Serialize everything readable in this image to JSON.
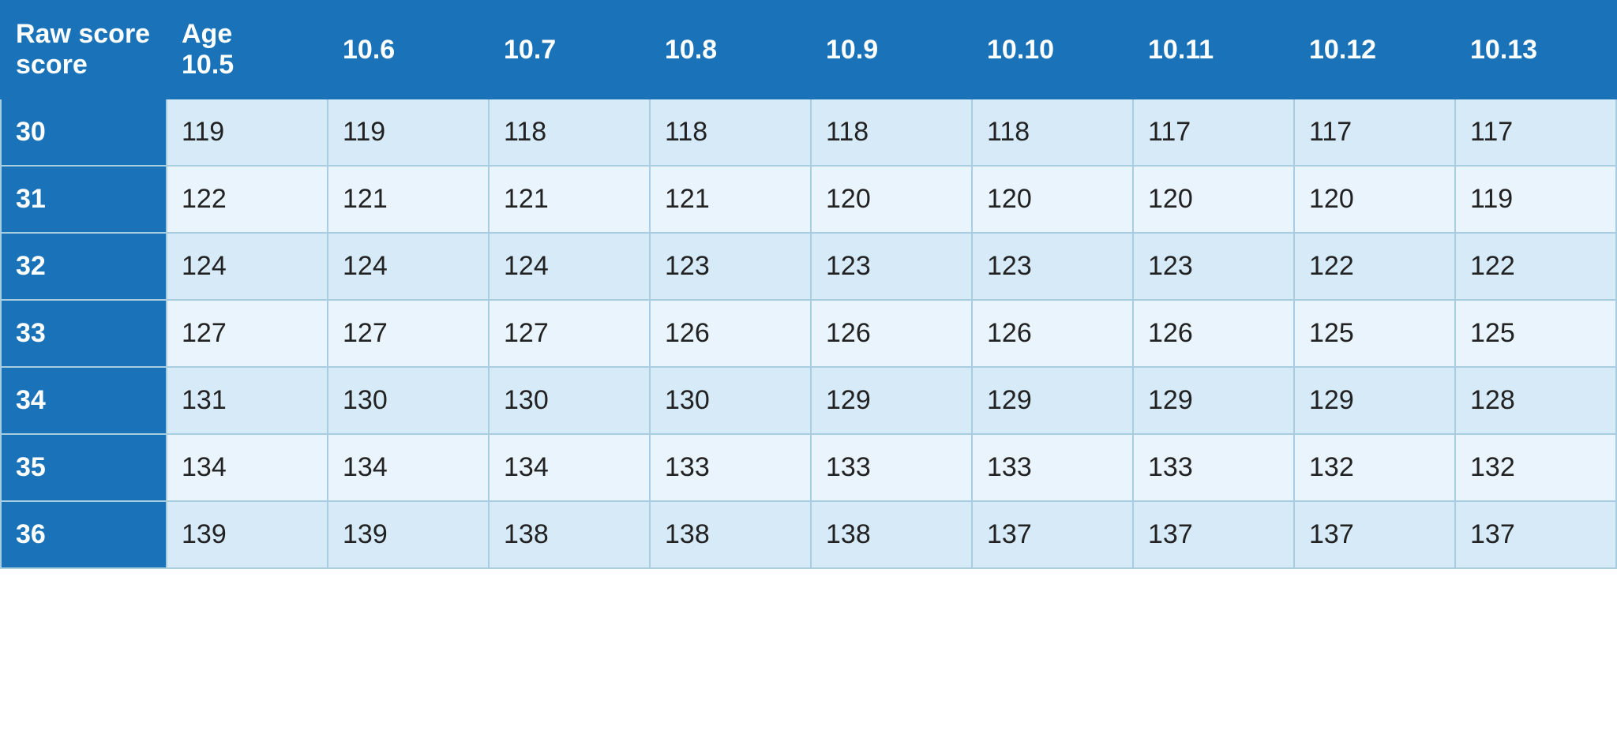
{
  "table": {
    "headers": [
      {
        "label": "Raw\nscore",
        "sub": ""
      },
      {
        "label": "Age\n10.5",
        "sub": "10.5"
      },
      {
        "label": "10.6",
        "sub": "10.6"
      },
      {
        "label": "10.7",
        "sub": "10.7"
      },
      {
        "label": "10.8",
        "sub": "10.8"
      },
      {
        "label": "10.9",
        "sub": "10.9"
      },
      {
        "label": "10.10",
        "sub": "10.10"
      },
      {
        "label": "10.11",
        "sub": "10.11"
      },
      {
        "label": "10.12",
        "sub": "10.12"
      },
      {
        "label": "10.13",
        "sub": "10.13"
      }
    ],
    "header_row_score": "Raw score",
    "header_row_age": "Age",
    "header_age_cols": [
      "10.5",
      "10.6",
      "10.7",
      "10.8",
      "10.9",
      "10.10",
      "10.11",
      "10.12",
      "10.13"
    ],
    "rows": [
      {
        "score": "30",
        "values": [
          "119",
          "119",
          "118",
          "118",
          "118",
          "118",
          "117",
          "117",
          "117"
        ]
      },
      {
        "score": "31",
        "values": [
          "122",
          "121",
          "121",
          "121",
          "120",
          "120",
          "120",
          "120",
          "119"
        ]
      },
      {
        "score": "32",
        "values": [
          "124",
          "124",
          "124",
          "123",
          "123",
          "123",
          "123",
          "122",
          "122"
        ]
      },
      {
        "score": "33",
        "values": [
          "127",
          "127",
          "127",
          "126",
          "126",
          "126",
          "126",
          "125",
          "125"
        ]
      },
      {
        "score": "34",
        "values": [
          "131",
          "130",
          "130",
          "130",
          "129",
          "129",
          "129",
          "129",
          "128"
        ]
      },
      {
        "score": "35",
        "values": [
          "134",
          "134",
          "134",
          "133",
          "133",
          "133",
          "133",
          "132",
          "132"
        ]
      },
      {
        "score": "36",
        "values": [
          "139",
          "139",
          "138",
          "138",
          "138",
          "137",
          "137",
          "137",
          "137"
        ]
      }
    ],
    "colors": {
      "header_bg": "#1a72b8",
      "row_score_bg": "#1a72b8",
      "odd_row": "#d6eaf8",
      "even_row": "#eaf4fc"
    }
  }
}
